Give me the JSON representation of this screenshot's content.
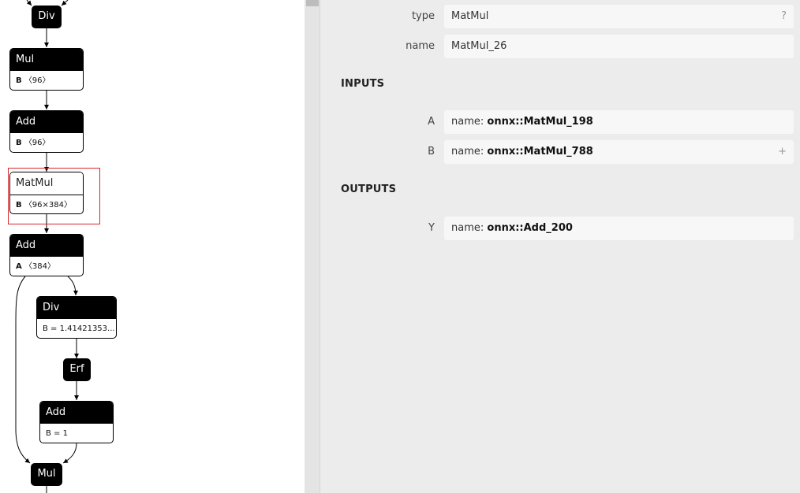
{
  "graph": {
    "nodes": {
      "div_top": {
        "op": "Div"
      },
      "mul1": {
        "op": "Mul",
        "attr_name": "B",
        "attr_value": "〈96〉"
      },
      "add1": {
        "op": "Add",
        "attr_name": "B",
        "attr_value": "〈96〉"
      },
      "matmul": {
        "op": "MatMul",
        "attr_name": "B",
        "attr_value": "〈96×384〉"
      },
      "add2": {
        "op": "Add",
        "attr_name": "A",
        "attr_value": "〈384〉"
      },
      "div2": {
        "op": "Div",
        "attr_value": "B = 1.41421353..."
      },
      "erf": {
        "op": "Erf"
      },
      "add3": {
        "op": "Add",
        "attr_value": "B = 1"
      },
      "mul2": {
        "op": "Mul"
      }
    }
  },
  "properties": {
    "type_label": "type",
    "type_value": "MatMul",
    "type_help": "?",
    "name_label": "name",
    "name_value": "MatMul_26",
    "inputs_title": "INPUTS",
    "inputs": [
      {
        "label": "A",
        "prefix": "name: ",
        "value": "onnx::MatMul_198",
        "side": ""
      },
      {
        "label": "B",
        "prefix": "name: ",
        "value": "onnx::MatMul_788",
        "side": "+"
      }
    ],
    "outputs_title": "OUTPUTS",
    "outputs": [
      {
        "label": "Y",
        "prefix": "name: ",
        "value": "onnx::Add_200"
      }
    ]
  }
}
